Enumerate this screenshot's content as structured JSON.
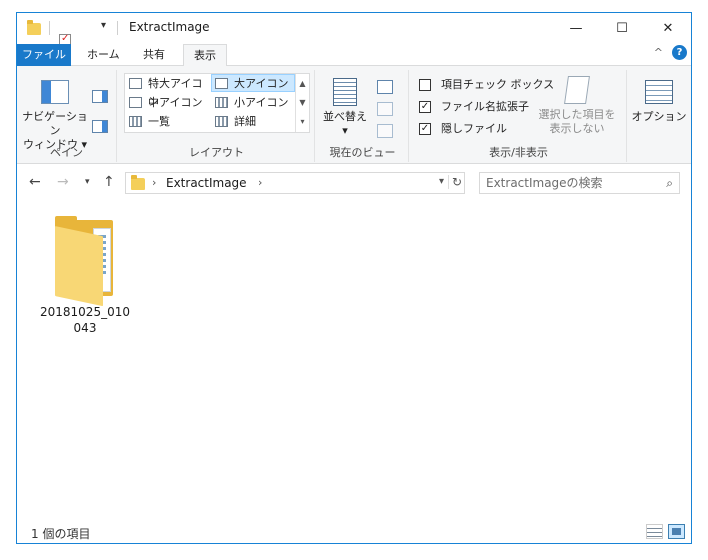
{
  "window": {
    "title": "ExtractImage",
    "minimize": "—",
    "maximize": "☐",
    "close": "✕"
  },
  "tabs": [
    {
      "label": "ファイル"
    },
    {
      "label": "ホーム"
    },
    {
      "label": "共有"
    },
    {
      "label": "表示"
    }
  ],
  "help": {
    "collapse": "^",
    "icon": "?"
  },
  "ribbon": {
    "pane_group": {
      "label": "ペイン",
      "nav_pane_line1": "ナビゲーション",
      "nav_pane_line2": "ウィンドウ ▾"
    },
    "layout_group": {
      "label": "レイアウト",
      "items": [
        {
          "label": "特大アイコン"
        },
        {
          "label": "大アイコン"
        },
        {
          "label": "中アイコン"
        },
        {
          "label": "小アイコン"
        },
        {
          "label": "一覧"
        },
        {
          "label": "詳細"
        }
      ]
    },
    "current_view_group": {
      "label": "現在のビュー",
      "sort_line1": "並べ替え",
      "sort_line2": "▾"
    },
    "show_hide_group": {
      "label": "表示/非表示",
      "checkboxes": [
        {
          "label": "項目チェック ボックス",
          "checked": false
        },
        {
          "label": "ファイル名拡張子",
          "checked": true
        },
        {
          "label": "隠しファイル",
          "checked": true
        }
      ],
      "hide_selected_line1": "選択した項目を",
      "hide_selected_line2": "表示しない"
    },
    "options": {
      "label": "オプション"
    }
  },
  "address_bar": {
    "path_segment": "ExtractImage",
    "search_placeholder": "ExtractImageの検索"
  },
  "content": {
    "items": [
      {
        "name": "20181025_010043",
        "type": "folder"
      }
    ]
  },
  "status_bar": {
    "item_count": "1 個の項目"
  }
}
